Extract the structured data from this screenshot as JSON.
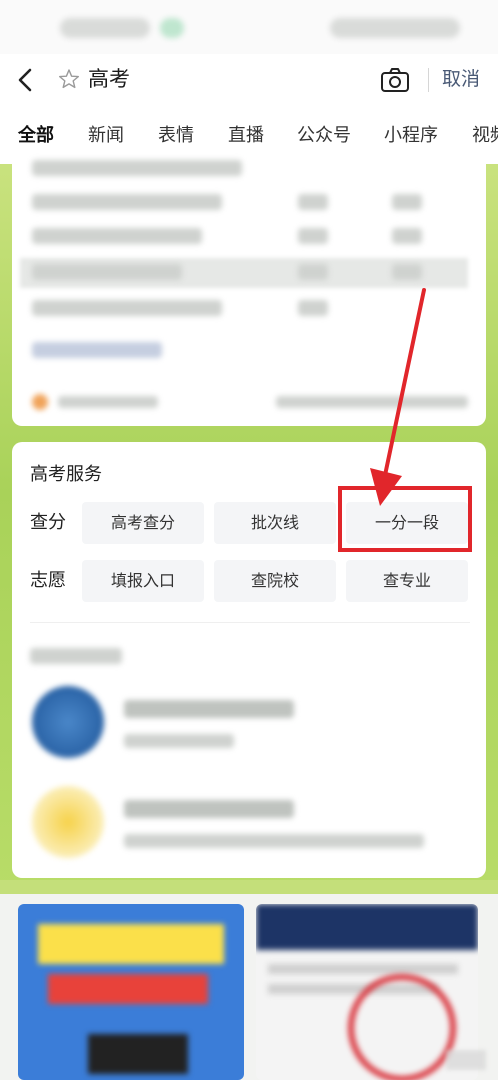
{
  "search": {
    "query": "高考",
    "cancel_label": "取消"
  },
  "tabs": [
    {
      "label": "全部",
      "active": true
    },
    {
      "label": "新闻"
    },
    {
      "label": "表情"
    },
    {
      "label": "直播"
    },
    {
      "label": "公众号"
    },
    {
      "label": "小程序"
    },
    {
      "label": "视频"
    }
  ],
  "services": {
    "title": "高考服务",
    "rows": [
      {
        "label": "查分",
        "buttons": [
          "高考查分",
          "批次线",
          "一分一段"
        ]
      },
      {
        "label": "志愿",
        "buttons": [
          "填报入口",
          "查院校",
          "查专业"
        ]
      }
    ],
    "highlighted_button": "一分一段"
  },
  "colors": {
    "annotation_red": "#e1262b",
    "cancel_text": "#4a5a76",
    "frame_green": "#a9d259"
  },
  "icons": [
    "back-icon",
    "star-icon",
    "camera-icon"
  ]
}
